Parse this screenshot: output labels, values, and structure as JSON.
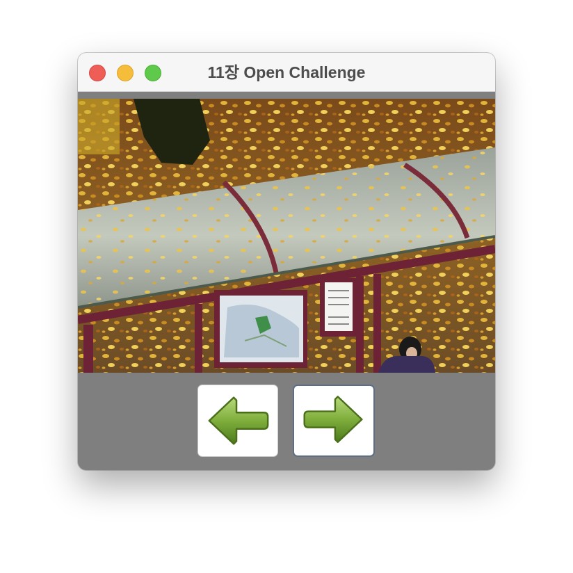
{
  "window": {
    "title": "11장 Open Challenge"
  },
  "image": {
    "description_icon": "photo-bus-shelter-autumn-leaves"
  },
  "controls": {
    "prev_icon": "left-arrow-icon",
    "next_icon": "right-arrow-icon"
  },
  "colors": {
    "button_bar": "#7f7f7f",
    "arrow_green": "#6a9a2c",
    "focus_border": "#5e6e86"
  }
}
